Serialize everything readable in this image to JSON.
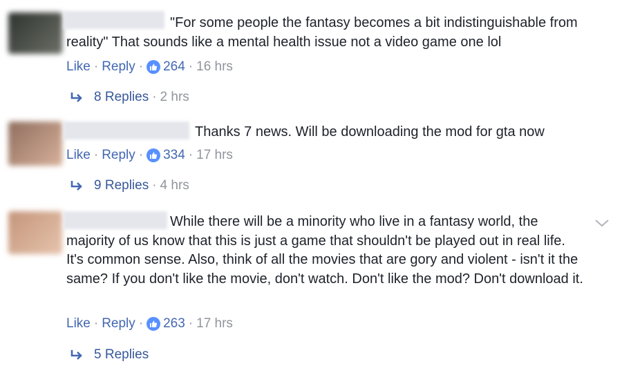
{
  "comments": [
    {
      "text": "\"For some people the fantasy becomes a bit indistinguishable from reality\" That sounds like a mental health issue not a video game one lol",
      "actions": {
        "like": "Like",
        "reply": "Reply",
        "like_count": "264",
        "time": "16 hrs"
      },
      "replies": {
        "label": "8 Replies",
        "time": "2 hrs"
      },
      "icons": {
        "like_badge": "thumbs-up-icon",
        "reply_arrow": "reply-arrow-icon"
      },
      "colors": {
        "avatar": "#4a4e4a"
      }
    },
    {
      "text": "Thanks 7 news. Will be downloading the mod for gta now",
      "actions": {
        "like": "Like",
        "reply": "Reply",
        "like_count": "334",
        "time": "17 hrs"
      },
      "replies": {
        "label": "9 Replies",
        "time": "4 hrs"
      },
      "icons": {
        "like_badge": "thumbs-up-icon",
        "reply_arrow": "reply-arrow-icon"
      },
      "colors": {
        "avatar": "#b98f7a"
      }
    },
    {
      "text": "While there will be a minority who live in a fantasy world, the majority of us know that this is just a game that shouldn't be played out in real life. It's common sense. Also, think of all the movies that are gory and violent - isn't it the same? If you don't like the movie, don't watch. Don't like the mod? Don't download it.",
      "actions": {
        "like": "Like",
        "reply": "Reply",
        "like_count": "263",
        "time": "17 hrs"
      },
      "replies": {
        "label": "5 Replies"
      },
      "icons": {
        "like_badge": "thumbs-up-icon",
        "reply_arrow": "reply-arrow-icon",
        "options": "chevron-down-icon"
      },
      "colors": {
        "avatar": "#d2a48c"
      }
    }
  ],
  "colors": {
    "link": "#4267b2",
    "meta": "#90949c",
    "like_badge": "#5890ff",
    "text": "#1d2129"
  }
}
